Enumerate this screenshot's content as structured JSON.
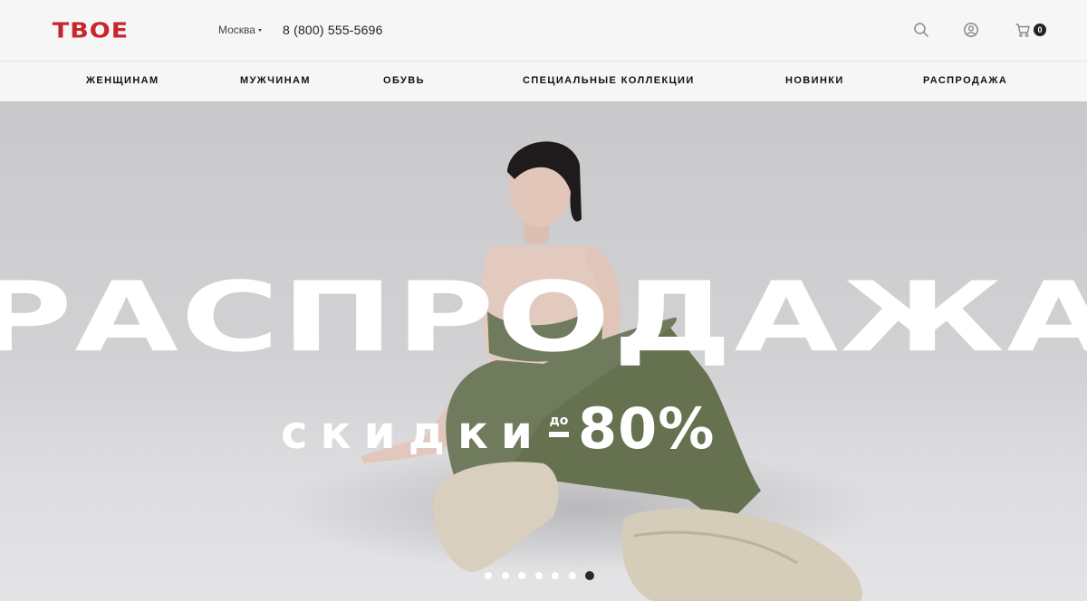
{
  "header": {
    "logo_text": "ТВОЕ",
    "city": "Москва",
    "phone": "8 (800) 555-5696",
    "cart_count": "0",
    "icons": [
      "search-icon",
      "user-icon",
      "cart-icon"
    ]
  },
  "nav": {
    "items": [
      {
        "label": "ЖЕНЩИНАМ"
      },
      {
        "label": "МУЖЧИНАМ"
      },
      {
        "label": "ОБУВЬ"
      },
      {
        "label": "СПЕЦИАЛЬНЫЕ КОЛЛЕКЦИИ"
      },
      {
        "label": "НОВИНКИ"
      },
      {
        "label": "РАСПРОДАЖА"
      }
    ]
  },
  "hero": {
    "headline": "РАСПРОДАЖА",
    "sub_word": "скидки",
    "sub_prefix": "до",
    "sub_value": "80%",
    "slides_total": 7,
    "active_slide": 7
  },
  "colors": {
    "brand": "#c8262b",
    "background": "#f6f6f6",
    "text": "#222222"
  }
}
